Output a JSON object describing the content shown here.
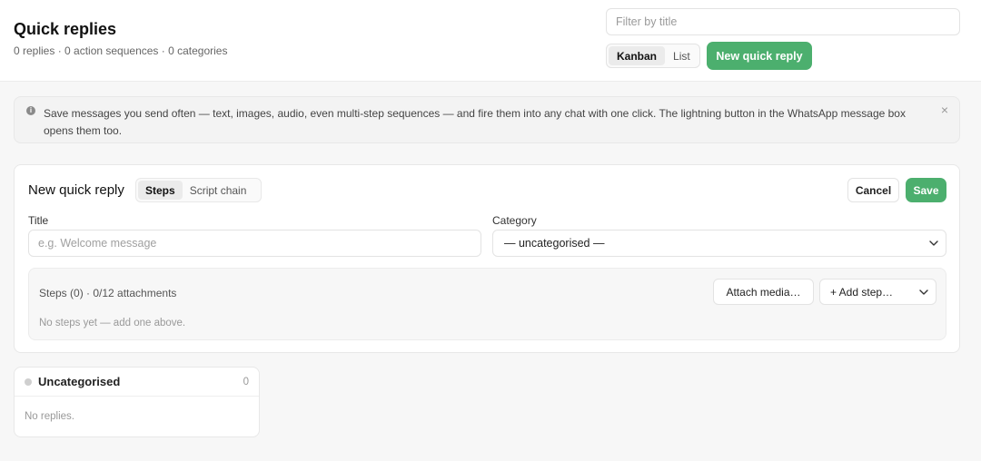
{
  "header": {
    "title": "Quick replies",
    "subtitle": "0 replies · 0 action sequences · 0 categories",
    "filter_placeholder": "Filter by title",
    "views": [
      {
        "label": "Kanban",
        "active": true
      },
      {
        "label": "List",
        "active": false
      }
    ],
    "new_button": "New quick reply"
  },
  "banner": {
    "icon": "info-icon",
    "text": "Save messages you send often — text, images, audio, even multi-step sequences — and fire them into any chat with one click. The lightning button in the WhatsApp message box opens them too.",
    "close": "×"
  },
  "form": {
    "title": "New quick reply",
    "modes": [
      {
        "label": "Steps",
        "active": true
      },
      {
        "label": "Script chain",
        "active": false
      }
    ],
    "cancel": "Cancel",
    "save": "Save",
    "title_label": "Title",
    "title_placeholder": "e.g. Welcome message",
    "category_label": "Category",
    "category_value": "— uncategorised —",
    "steps": {
      "heading": "Steps (0) · 0/12 attachments",
      "empty": "No steps yet — add one above.",
      "attach": "Attach media…",
      "add_step": "+ Add step…"
    }
  },
  "kanban": {
    "columns": [
      {
        "title": "Uncategorised",
        "count": "0",
        "empty": "No replies."
      }
    ]
  },
  "colors": {
    "accent": "#4caf6e",
    "background": "#f7f7f7"
  }
}
